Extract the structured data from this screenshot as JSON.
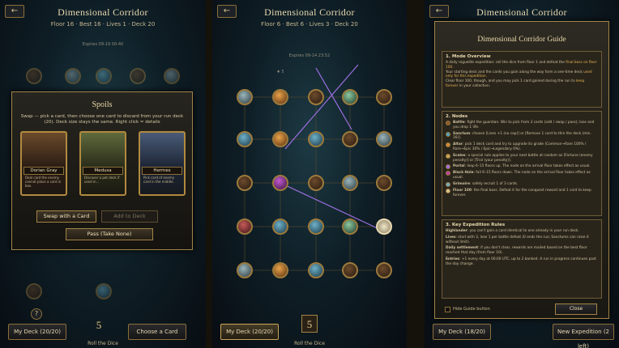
{
  "panels": [
    {
      "title": "Dimensional Corridor",
      "stats": "Floor 16 · Best 16 · Lives 1 · Deck 20",
      "expires": "Expires 09-19 00:40",
      "spoils": {
        "title": "Spoils",
        "description": "Swap — pick a card, then choose one card to discard from your run deck (20). Deck size stays the same. Right click = details",
        "cards": [
          {
            "name": "Dorian Gray",
            "text": "Deal card the enemy cannot place a card in box."
          },
          {
            "name": "Medusa",
            "text": "Discover a pet deck if used in..."
          },
          {
            "name": "Hermes",
            "text": "Pick card of enemy card in the middle."
          }
        ],
        "swap_label": "Swap with a Card",
        "add_label": "Add to Deck",
        "pass_label": "Pass (Take None)"
      },
      "help": "?",
      "deck_label": "My Deck (20/20)",
      "die_value": "5",
      "choose_label": "Choose a Card",
      "roll_label": "Roll the Dice"
    },
    {
      "title": "Dimensional Corridor",
      "stats": "Floor 6 · Best 6 · Lives 3 · Deck 20",
      "expires": "Expires 09-14 23:52",
      "floor_marker": "♦ 5",
      "deck_label": "My Deck (20/20)",
      "die_value": "5",
      "roll_label": "Roll the Dice"
    },
    {
      "title": "Dimensional Corridor",
      "guide": {
        "title": "Dimensional Corridor Guide",
        "sections": {
          "overview": {
            "head": "1. Mode Overview",
            "p1": "A daily roguelite expedition: roll the dice from floor 1 and defeat the ",
            "p1_hl": "final boss on floor 100.",
            "p2": "Your starting deck and the cards you gain along the way form a one-time deck ",
            "p2_hl": "used only for this expedition.",
            "p3": "Clear floor 100, though, and you may pick 1 card gained during the run to ",
            "p3_hl": "keep forever",
            "p3_end": " in your collection."
          },
          "nodes": {
            "head": "2. Nodes",
            "items": [
              {
                "name": "Battle",
                "text": ": fight the guardian. Win to pick from 3 cards (add / swap / pass); lose and you drop 1 life."
              },
              {
                "name": "Sanctum",
                "text": ": choose [Lives +1 (no cap)] or [Remove 1 card to thin the deck (min. 16)]."
              },
              {
                "name": "Altar",
                "text": ": pick 1 deck card and try to upgrade its grade (Common→Rare 100% / Rare→Epic 30% / Epic→Legendary 0%)."
              },
              {
                "name": "Scales",
                "text": ": a special rule applies to your next battle at random as [Fortune (enemy penalty)] or [Trial (your penalty)]."
              },
              {
                "name": "Portal",
                "text": ": leap 6–15 floors up. The node on the arrival floor takes effect as usual."
              },
              {
                "name": "Black Hole",
                "text": ": fall 6–15 floors down. The node on the arrival floor takes effect as usual."
              },
              {
                "name": "Grimoire",
                "text": ": safely recruit 1 of 3 cards."
              },
              {
                "name": "Floor 100",
                "text": ": the final boss. Defeat it for the conquest reward and 1 card to keep forever."
              }
            ]
          },
          "rules": {
            "head": "3. Key Expedition Rules",
            "items": [
              {
                "name": "Highlander",
                "text": ": you can't gain a card identical to one already in your run deck."
              },
              {
                "name": "Lives",
                "text": ": start with 3, lose 1 per battle defeat (0 ends the run; Sanctums can raise it without limit)."
              },
              {
                "name": "Daily settlement",
                "text": ": if you don't clear, rewards are mailed based on the best floor reached that day (from floor 10)."
              },
              {
                "name": "Entries",
                "text": ": +1 every day at 00:00 UTC, up to 2 banked. A run in progress continues past the day change."
              }
            ]
          }
        },
        "hide_label": "Hide Guide button",
        "close_label": "Close"
      },
      "deck_label": "My Deck (18/20)",
      "new_label": "New Expedition (2 left)"
    }
  ]
}
